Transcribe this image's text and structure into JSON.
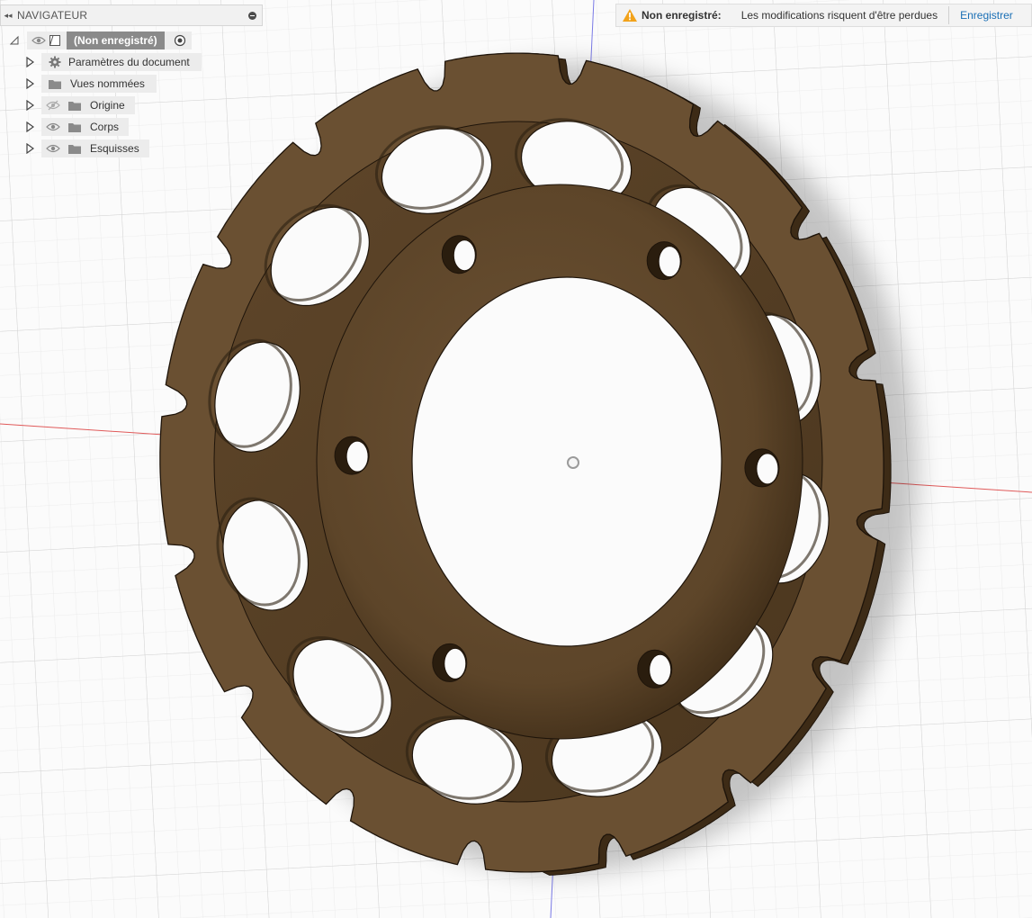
{
  "navigator": {
    "title": "NAVIGATEUR",
    "root_label": "(Non enregistré)",
    "items": [
      {
        "label": "Paramètres du document",
        "icon": "gear-icon"
      },
      {
        "label": "Vues nommées",
        "icon": "folder-icon"
      },
      {
        "label": "Origine",
        "icon": "folder-icon",
        "visibility": "hidden"
      },
      {
        "label": "Corps",
        "icon": "folder-icon",
        "visibility": "visible"
      },
      {
        "label": "Esquisses",
        "icon": "folder-icon",
        "visibility": "visible"
      }
    ]
  },
  "notification": {
    "icon": "warning-icon",
    "title": "Non enregistré:",
    "message": "Les modifications risquent d'être perdues",
    "action": "Enregistrer"
  },
  "colors": {
    "part": "#6a5032",
    "part_dark": "#3f2d18",
    "accent": "#1a6fb5",
    "warning": "#f2a21a",
    "x_axis": "#e05a5a",
    "y_axis": "#7a7ae6"
  }
}
